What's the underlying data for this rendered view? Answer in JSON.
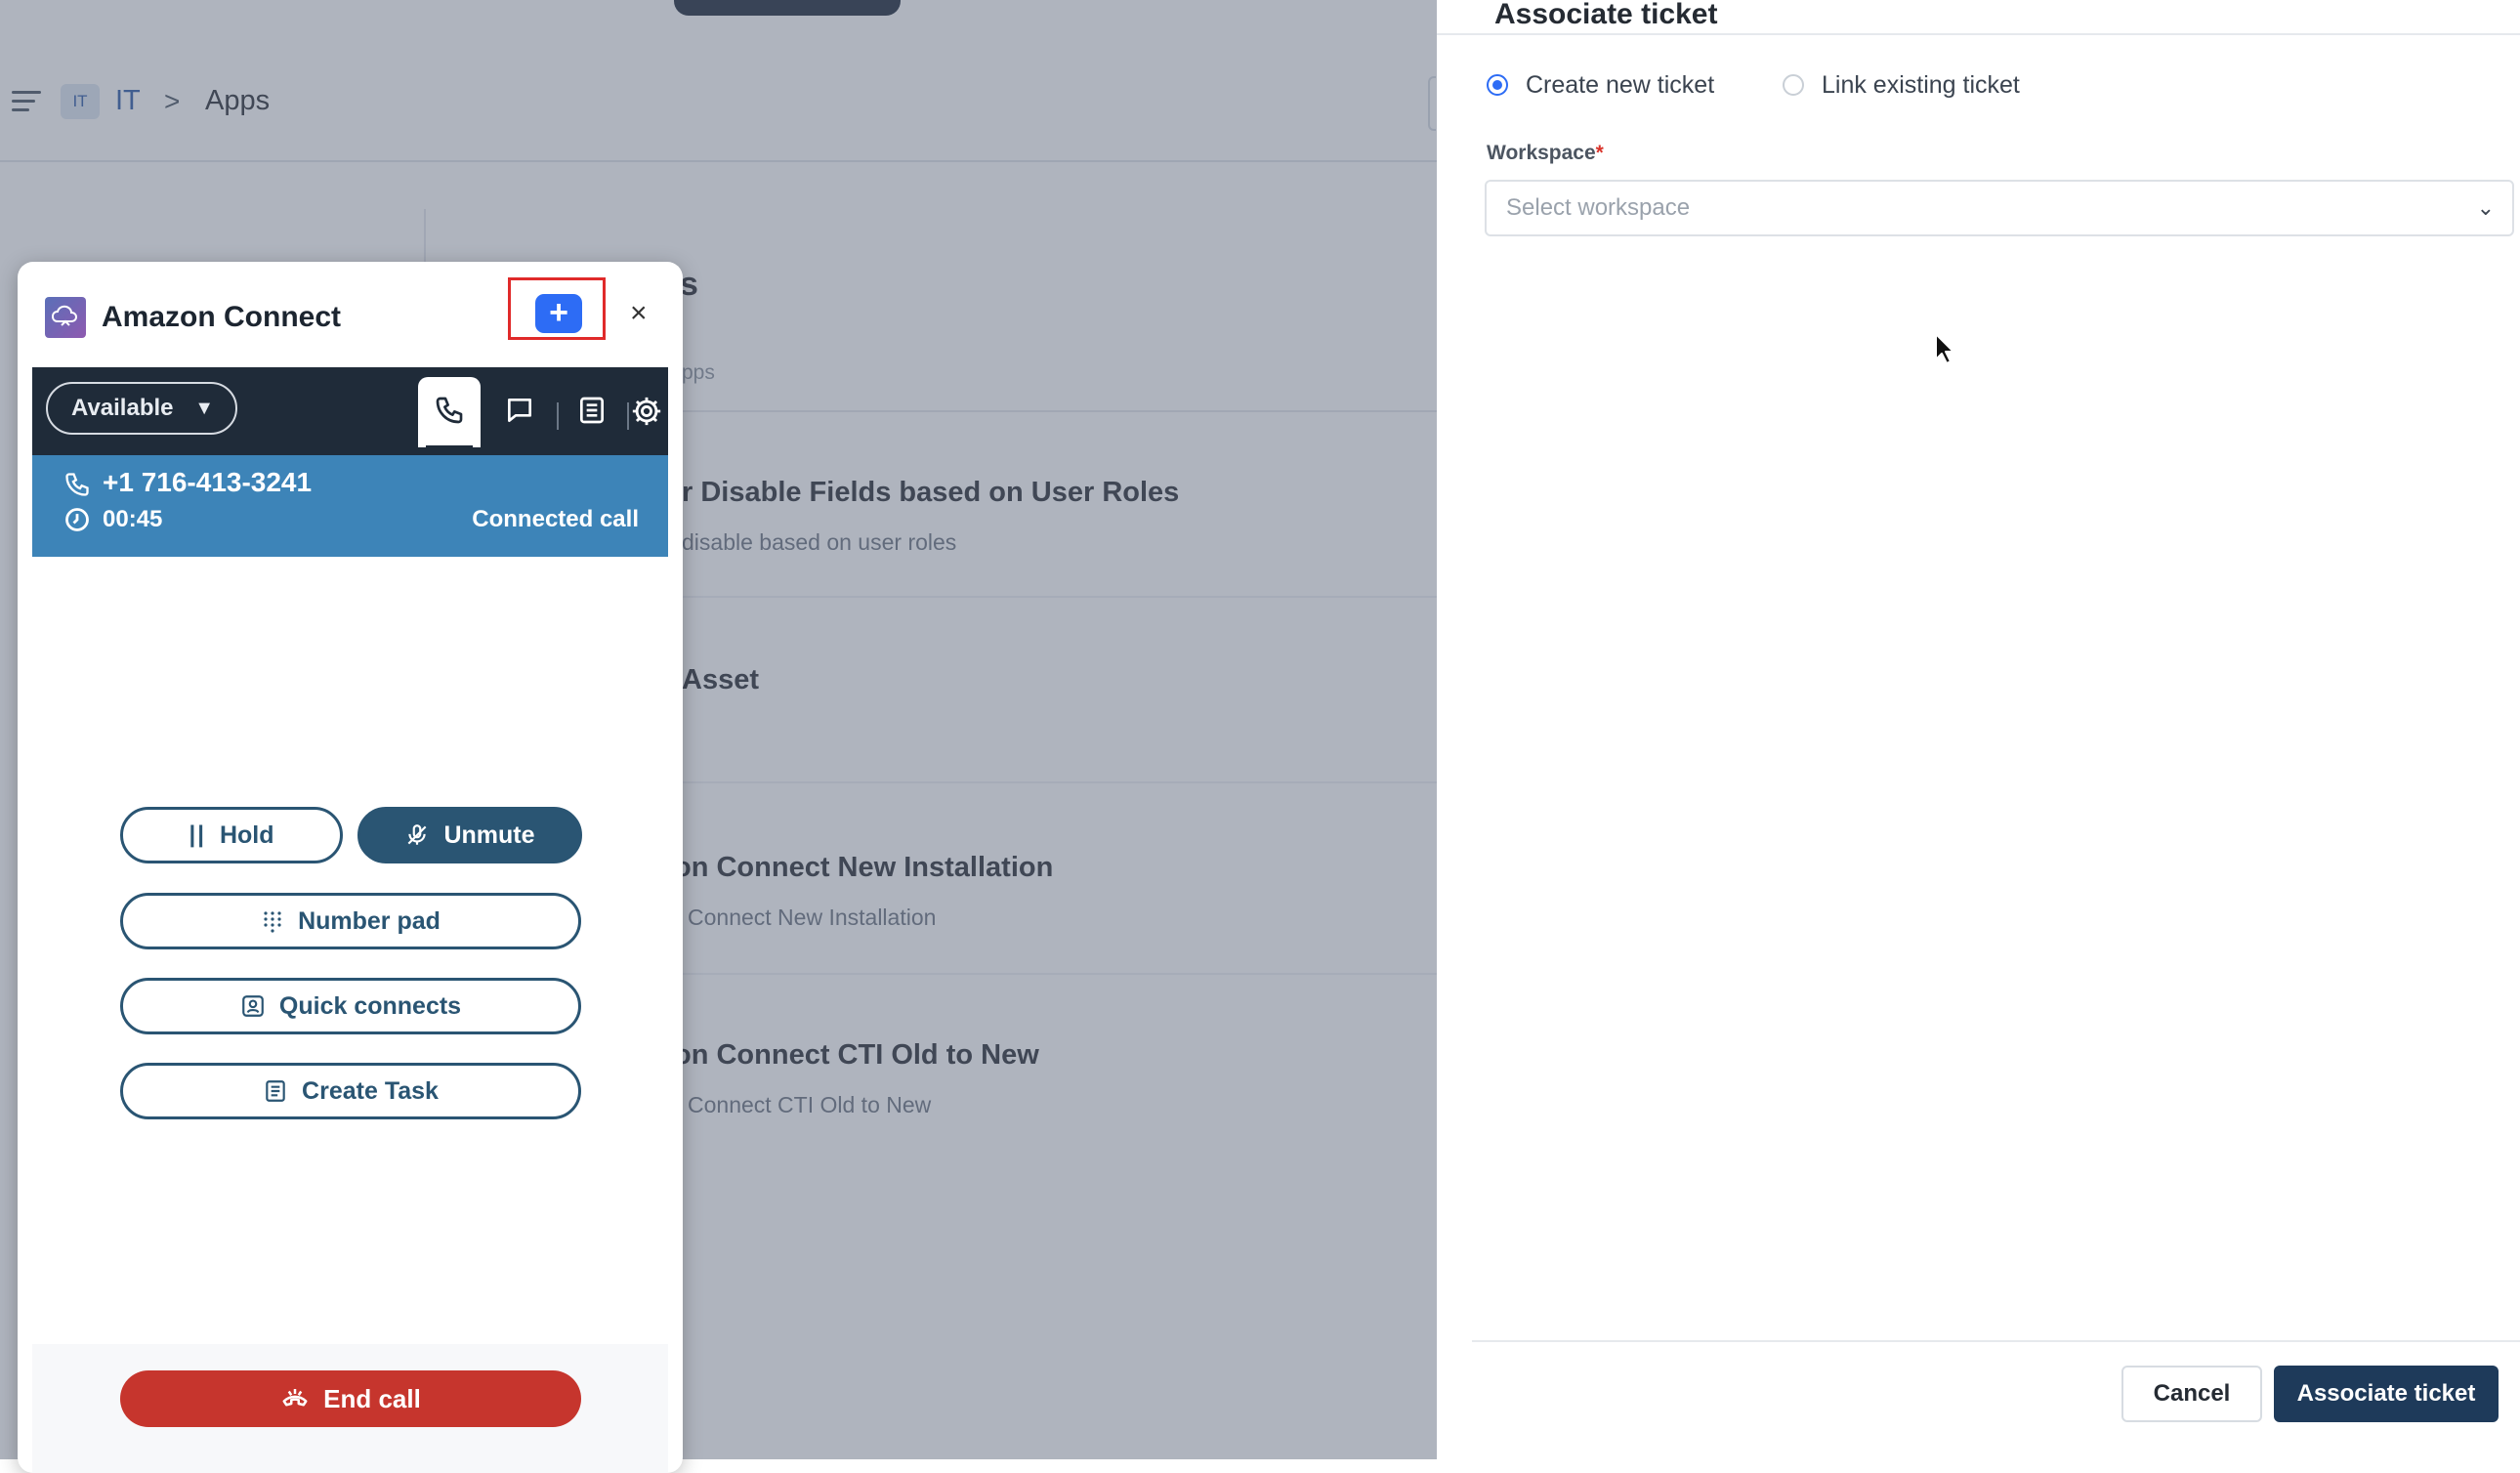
{
  "background_app": {
    "breadcrumb": {
      "badge": "IT",
      "root": "IT",
      "separator": ">",
      "current": "Apps"
    },
    "section_heading_fragment": "s",
    "section_sub_fragment": "pps",
    "rows": [
      {
        "title": "r Disable Fields based on User Roles",
        "subtitle": "disable based on user roles"
      },
      {
        "title": "Asset",
        "subtitle": ""
      },
      {
        "title": "on Connect New Installation",
        "subtitle": "Connect New Installation"
      },
      {
        "title": "on Connect CTI Old to New",
        "subtitle": "Connect CTI Old to New"
      }
    ]
  },
  "widget": {
    "title": "Amazon Connect",
    "add_label": "+",
    "close_label": "×",
    "status": "Available",
    "call": {
      "number": "+1 716-413-3241",
      "duration": "00:45",
      "state": "Connected call"
    },
    "buttons": {
      "hold": "Hold",
      "unmute": "Unmute",
      "number_pad": "Number pad",
      "quick_connects": "Quick connects",
      "create_task": "Create Task",
      "end_call": "End call"
    },
    "colors": {
      "ccp_bar": "#1f2b39",
      "call_bar": "#3d84b8",
      "end_call": "#c6352d",
      "add_button": "#2d6cf5"
    }
  },
  "drawer": {
    "title": "Associate ticket",
    "radio_create": "Create new ticket",
    "radio_link": "Link existing ticket",
    "selected_option": "Create new ticket",
    "workspace_label": "Workspace",
    "required_mark": "*",
    "workspace_placeholder": "Select workspace",
    "cancel": "Cancel",
    "submit": "Associate ticket"
  }
}
